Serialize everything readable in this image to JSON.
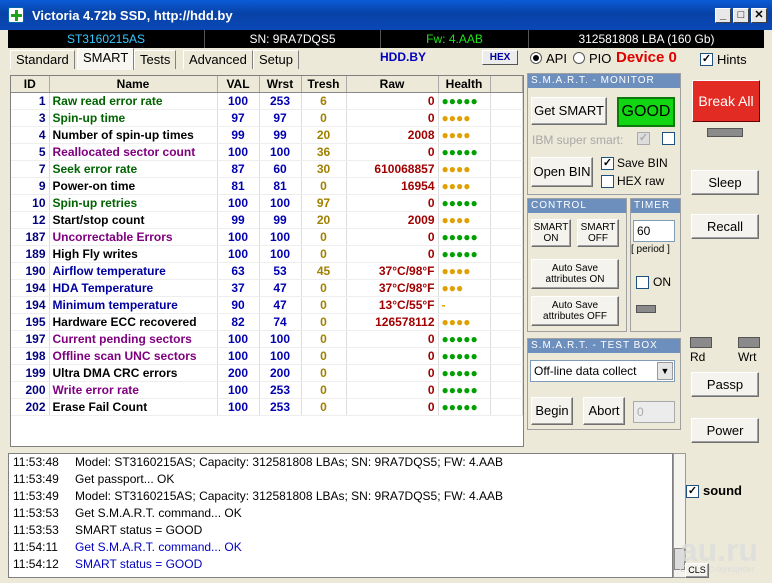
{
  "window": {
    "title": "Victoria 4.72b SSD, http://hdd.by"
  },
  "infobar": {
    "model": "ST3160215AS",
    "serial": "SN: 9RA7DQS5",
    "firmware": "Fw: 4.AAB",
    "capacity": "312581808 LBA (160 Gb)"
  },
  "tabs": [
    "Standard",
    "SMART",
    "Tests",
    "Advanced",
    "Setup"
  ],
  "active_tab": "SMART",
  "brand": "HDD.BY",
  "hex_label": "HEX",
  "mode": {
    "api": "API",
    "pio": "PIO",
    "device": "Device 0",
    "hints": "Hints"
  },
  "table": {
    "columns": [
      "ID",
      "Name",
      "VAL",
      "Wrst",
      "Tresh",
      "Raw",
      "Health"
    ],
    "rows": [
      {
        "id": "1",
        "name": "Raw read error rate",
        "val": "100",
        "wrst": "253",
        "tresh": "6",
        "raw": "0",
        "health": "●●●●●",
        "ncolor": "#006400",
        "hcolor": "#00a000"
      },
      {
        "id": "3",
        "name": "Spin-up time",
        "val": "97",
        "wrst": "97",
        "tresh": "0",
        "raw": "0",
        "health": "●●●●",
        "ncolor": "#006400",
        "hcolor": "#e0a000"
      },
      {
        "id": "4",
        "name": "Number of spin-up times",
        "val": "99",
        "wrst": "99",
        "tresh": "20",
        "raw": "2008",
        "health": "●●●●",
        "ncolor": "#000000",
        "hcolor": "#e0a000"
      },
      {
        "id": "5",
        "name": "Reallocated sector count",
        "val": "100",
        "wrst": "100",
        "tresh": "36",
        "raw": "0",
        "health": "●●●●●",
        "ncolor": "#800080",
        "hcolor": "#00a000"
      },
      {
        "id": "7",
        "name": "Seek error rate",
        "val": "87",
        "wrst": "60",
        "tresh": "30",
        "raw": "610068857",
        "health": "●●●●",
        "ncolor": "#006400",
        "hcolor": "#e0a000"
      },
      {
        "id": "9",
        "name": "Power-on time",
        "val": "81",
        "wrst": "81",
        "tresh": "0",
        "raw": "16954",
        "health": "●●●●",
        "ncolor": "#000000",
        "hcolor": "#e0a000"
      },
      {
        "id": "10",
        "name": "Spin-up retries",
        "val": "100",
        "wrst": "100",
        "tresh": "97",
        "raw": "0",
        "health": "●●●●●",
        "ncolor": "#006400",
        "hcolor": "#00a000"
      },
      {
        "id": "12",
        "name": "Start/stop count",
        "val": "99",
        "wrst": "99",
        "tresh": "20",
        "raw": "2009",
        "health": "●●●●",
        "ncolor": "#000000",
        "hcolor": "#e0a000"
      },
      {
        "id": "187",
        "name": "Uncorrectable Errors",
        "val": "100",
        "wrst": "100",
        "tresh": "0",
        "raw": "0",
        "health": "●●●●●",
        "ncolor": "#800080",
        "hcolor": "#00a000"
      },
      {
        "id": "189",
        "name": "High Fly writes",
        "val": "100",
        "wrst": "100",
        "tresh": "0",
        "raw": "0",
        "health": "●●●●●",
        "ncolor": "#000000",
        "hcolor": "#00a000"
      },
      {
        "id": "190",
        "name": "Airflow temperature",
        "val": "63",
        "wrst": "53",
        "tresh": "45",
        "raw": "37°C/98°F",
        "health": "●●●●",
        "ncolor": "#0000a0",
        "hcolor": "#e0a000"
      },
      {
        "id": "194",
        "name": "HDA Temperature",
        "val": "37",
        "wrst": "47",
        "tresh": "0",
        "raw": "37°C/98°F",
        "health": "●●●",
        "ncolor": "#0000a0",
        "hcolor": "#e0a000"
      },
      {
        "id": "194",
        "name": "Minimum temperature",
        "val": "90",
        "wrst": "47",
        "tresh": "0",
        "raw": "13°C/55°F",
        "health": "-",
        "ncolor": "#0000a0",
        "hcolor": "#e0a000"
      },
      {
        "id": "195",
        "name": "Hardware ECC recovered",
        "val": "82",
        "wrst": "74",
        "tresh": "0",
        "raw": "126578112",
        "health": "●●●●",
        "ncolor": "#000000",
        "hcolor": "#e0a000"
      },
      {
        "id": "197",
        "name": "Current pending sectors",
        "val": "100",
        "wrst": "100",
        "tresh": "0",
        "raw": "0",
        "health": "●●●●●",
        "ncolor": "#800080",
        "hcolor": "#00a000"
      },
      {
        "id": "198",
        "name": "Offline scan UNC sectors",
        "val": "100",
        "wrst": "100",
        "tresh": "0",
        "raw": "0",
        "health": "●●●●●",
        "ncolor": "#800080",
        "hcolor": "#00a000"
      },
      {
        "id": "199",
        "name": "Ultra DMA CRC errors",
        "val": "200",
        "wrst": "200",
        "tresh": "0",
        "raw": "0",
        "health": "●●●●●",
        "ncolor": "#000000",
        "hcolor": "#00a000"
      },
      {
        "id": "200",
        "name": "Write error rate",
        "val": "100",
        "wrst": "253",
        "tresh": "0",
        "raw": "0",
        "health": "●●●●●",
        "ncolor": "#800080",
        "hcolor": "#00a000"
      },
      {
        "id": "202",
        "name": "Erase Fail Count",
        "val": "100",
        "wrst": "253",
        "tresh": "0",
        "raw": "0",
        "health": "●●●●●",
        "ncolor": "#000000",
        "hcolor": "#00a000"
      }
    ]
  },
  "smart_monitor": {
    "title": "S.M.A.R.T. - MONITOR",
    "get_smart": "Get SMART",
    "status": "GOOD",
    "ibm": "IBM super smart:",
    "open_bin": "Open BIN",
    "save_bin": "Save BIN",
    "hex_raw": "HEX raw"
  },
  "control": {
    "title": "CONTROL",
    "smart_on": "SMART ON",
    "smart_off": "SMART OFF",
    "autosave_on": "Auto Save attributes ON",
    "autosave_off": "Auto Save attributes OFF"
  },
  "timer": {
    "title": "TIMER",
    "value": "60",
    "period": "[ period ]",
    "on": "ON"
  },
  "test_box": {
    "title": "S.M.A.R.T. - TEST BOX",
    "selected": "Off-line data collect",
    "begin": "Begin",
    "abort": "Abort",
    "progress": "0"
  },
  "side": {
    "break_all": "Break All",
    "sleep": "Sleep",
    "recall": "Recall",
    "rd": "Rd",
    "wrt": "Wrt",
    "passp": "Passp",
    "power": "Power",
    "sound": "sound",
    "cls": "CLS"
  },
  "log": [
    {
      "time": "11:53:48",
      "text": "Model: ST3160215AS; Capacity: 312581808 LBAs; SN: 9RA7DQS5; FW: 4.AAB",
      "color": "#000000"
    },
    {
      "time": "11:53:49",
      "text": "Get passport... OK",
      "color": "#000000"
    },
    {
      "time": "11:53:49",
      "text": "Model: ST3160215AS; Capacity: 312581808 LBAs; SN: 9RA7DQS5; FW: 4.AAB",
      "color": "#000000"
    },
    {
      "time": "11:53:53",
      "text": "Get S.M.A.R.T. command... OK",
      "color": "#000000"
    },
    {
      "time": "11:53:53",
      "text": "SMART status = GOOD",
      "color": "#000000"
    },
    {
      "time": "11:54:11",
      "text": "Get S.M.A.R.T. command... OK",
      "color": "#0000c0"
    },
    {
      "time": "11:54:12",
      "text": "SMART status = GOOD",
      "color": "#0000c0"
    }
  ],
  "watermark": {
    "logo": "au.ru",
    "tagline": "Сервис-аукцион"
  }
}
